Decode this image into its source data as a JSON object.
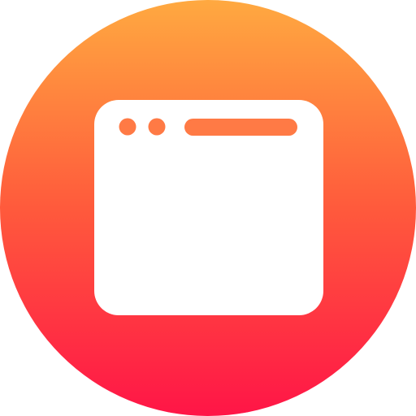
{
  "icon": {
    "name": "browser-window-icon",
    "colors": {
      "gradient_top": "#FFA940",
      "gradient_mid": "#FF5A3C",
      "gradient_bottom": "#FF1547",
      "window_fill": "#FFFFFF",
      "window_controls": "#FF7A45"
    }
  }
}
